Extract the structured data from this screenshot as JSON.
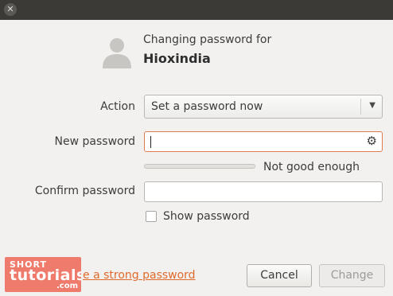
{
  "window": {
    "close_glyph": "✕"
  },
  "header": {
    "avatar_icon": "user-avatar-icon",
    "subtitle": "Changing password for",
    "username": "Hioxindia"
  },
  "form": {
    "action_label": "Action",
    "action_value": "Set a password now",
    "action_dropdown_glyph": "▼",
    "new_password_label": "New password",
    "new_password_value": "",
    "generate_icon_glyph": "⚙",
    "strength_text": "Not good enough",
    "strength_level": 0,
    "confirm_password_label": "Confirm password",
    "confirm_password_value": "",
    "show_password_label": "Show password",
    "show_password_checked": false
  },
  "footer": {
    "link_text": "e a strong password",
    "cancel_label": "Cancel",
    "change_label": "Change"
  },
  "watermark": {
    "line1": "SHORT",
    "line2": "tutorials",
    "line3": ".com"
  },
  "colors": {
    "accent": "#e06a2c",
    "titlebar": "#3b3a36",
    "background": "#f2f1f0",
    "focus_border": "#e07b4f"
  }
}
